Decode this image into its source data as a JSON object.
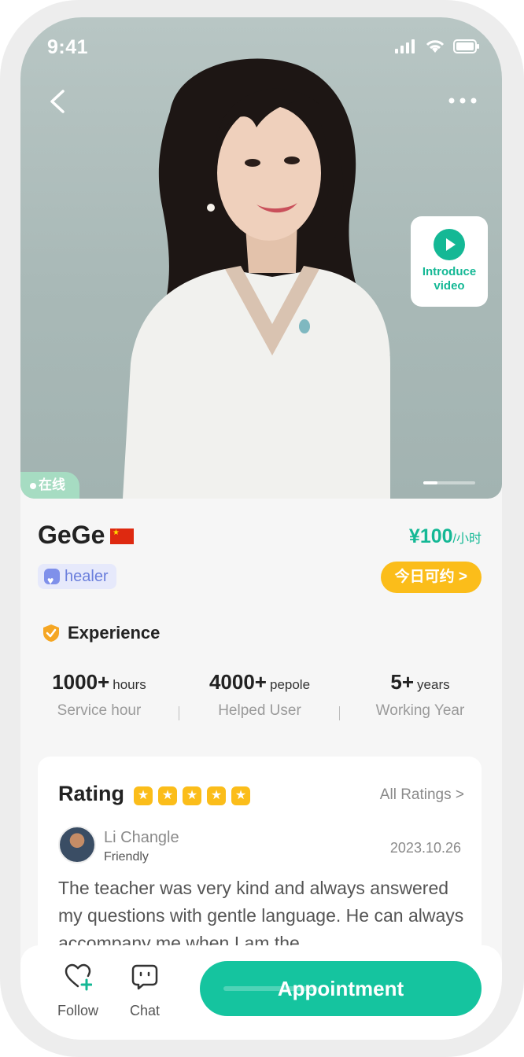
{
  "status_bar": {
    "time": "9:41"
  },
  "hero": {
    "video_label": "Introduce video",
    "online_label": "在线"
  },
  "profile": {
    "name": "GeGe",
    "flag": "china-flag-icon",
    "price_amount": "¥100",
    "price_unit": "/小时",
    "role_tag": "healer",
    "book_today": "今日可约 >"
  },
  "experience": {
    "title": "Experience",
    "stats": [
      {
        "value": "1000+",
        "unit": "hours",
        "label": "Service hour"
      },
      {
        "value": "4000+",
        "unit": "pepole",
        "label": "Helped User"
      },
      {
        "value": "5+",
        "unit": "years",
        "label": "Working Year"
      }
    ]
  },
  "rating": {
    "title": "Rating",
    "stars": 5,
    "all_label": "All Ratings >",
    "review": {
      "reviewer": "Li Changle",
      "tag": "Friendly",
      "date": "2023.10.26",
      "text": "The teacher was very kind and always answered my questions with gentle language. He can always accompany me when I am the"
    }
  },
  "bottom_bar": {
    "follow_label": "Follow",
    "chat_label": "Chat",
    "appointment_label": "Appointment"
  },
  "colors": {
    "accent": "#14b895",
    "yellow": "#fbbd1a",
    "tag_blue": "#6b7fdc"
  }
}
